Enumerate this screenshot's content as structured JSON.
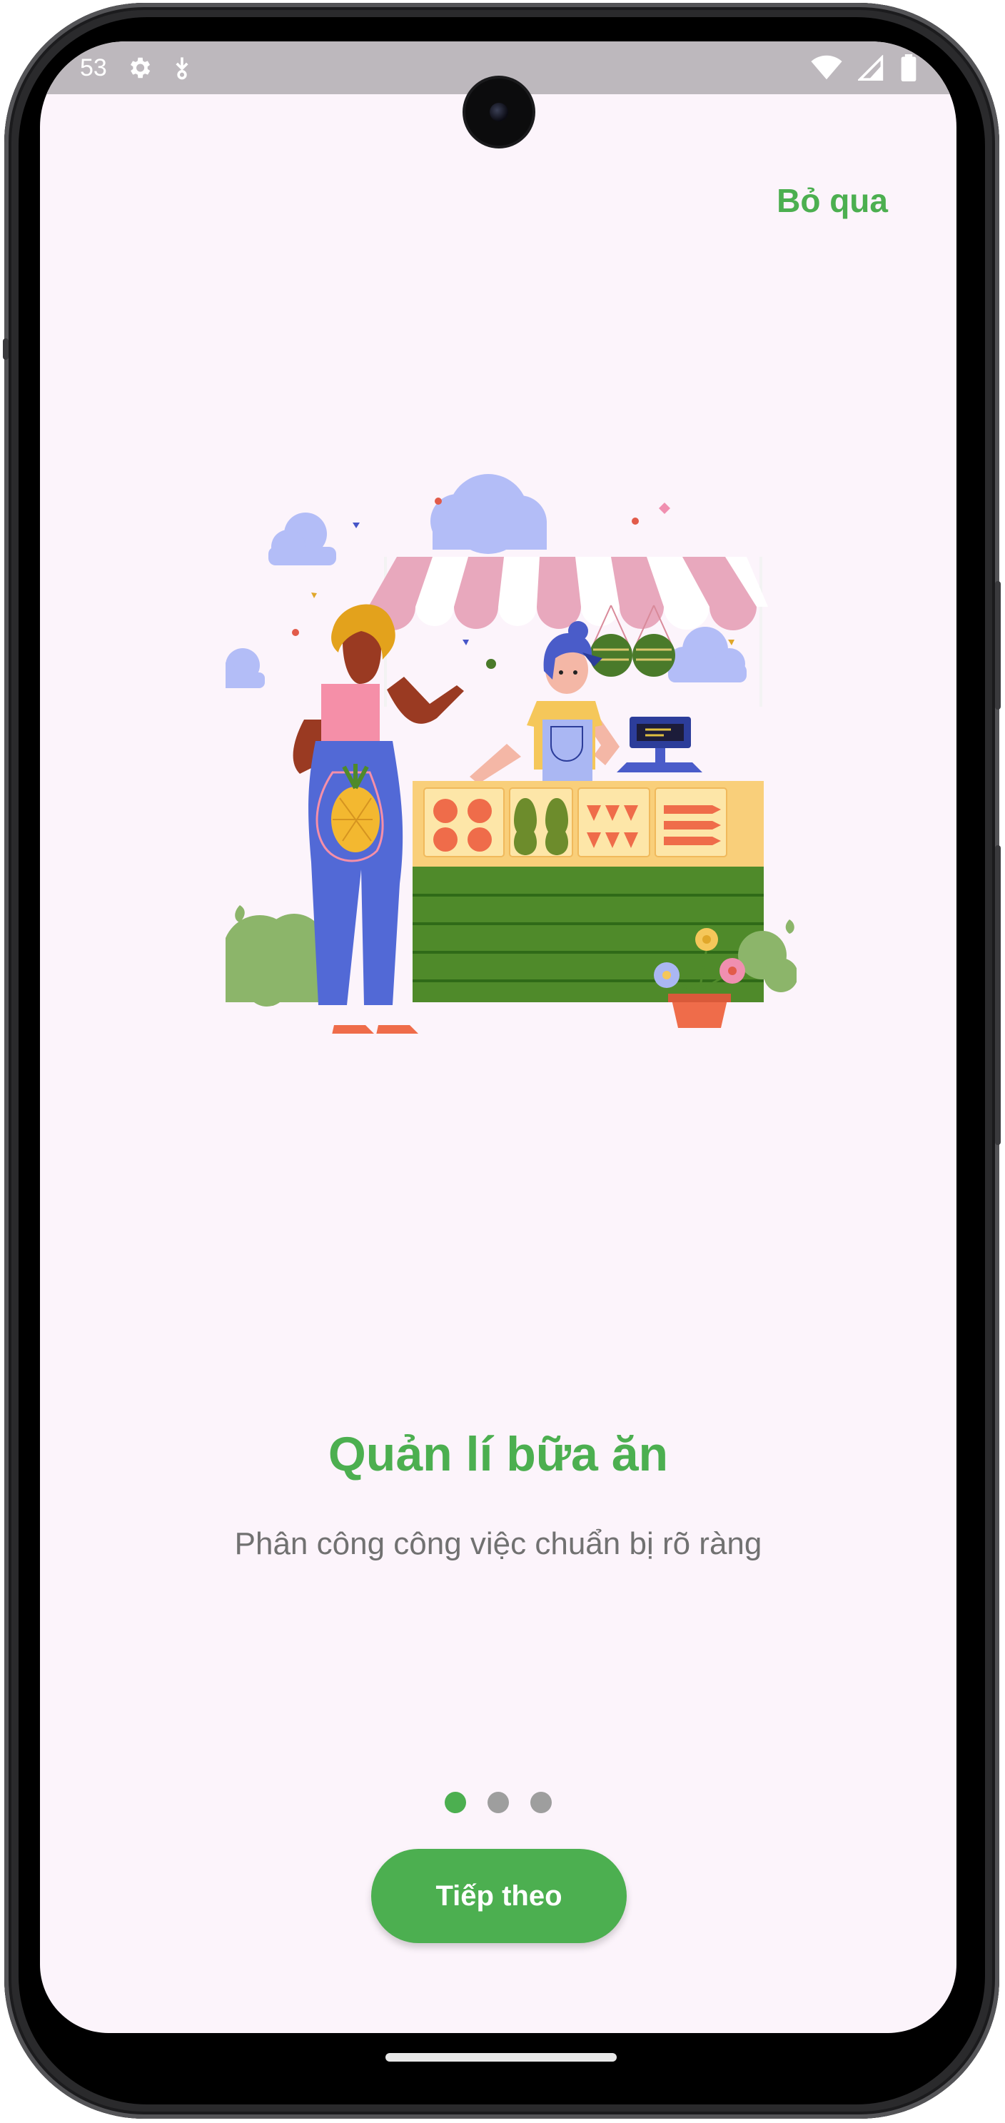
{
  "status_bar": {
    "time": "53",
    "icons": [
      "settings-icon",
      "download-icon",
      "wifi-icon",
      "signal-icon",
      "battery-icon"
    ]
  },
  "onboarding": {
    "skip_label": "Bỏ qua",
    "title": "Quản lí bữa ăn",
    "subtitle": "Phân công công việc chuẩn bị rõ ràng",
    "next_label": "Tiếp theo",
    "page_index": 1,
    "page_count": 3
  },
  "colors": {
    "accent": "#4caf50",
    "background": "#fcf4fb",
    "subtitle_text": "#717171",
    "inactive_dot": "#9e9e9e"
  }
}
